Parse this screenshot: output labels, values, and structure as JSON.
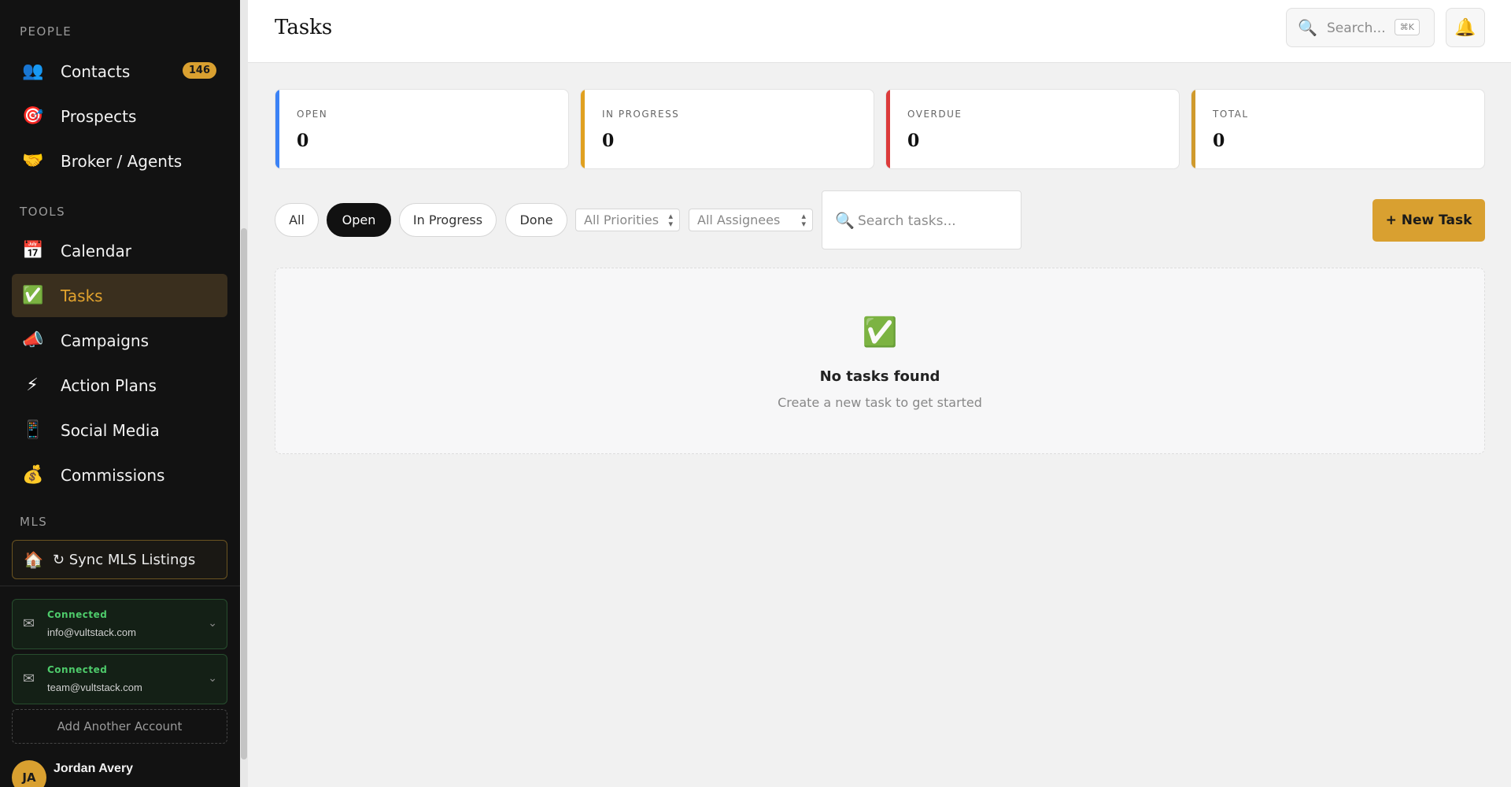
{
  "sidebar": {
    "sections": {
      "people": "PEOPLE",
      "tools": "TOOLS",
      "mls": "MLS"
    },
    "people_items": [
      {
        "icon": "👥",
        "label": "Contacts",
        "badge": "146"
      },
      {
        "icon": "🎯",
        "label": "Prospects"
      },
      {
        "icon": "🤝",
        "label": "Broker / Agents"
      }
    ],
    "tool_items": [
      {
        "icon": "📅",
        "label": "Calendar"
      },
      {
        "icon": "✅",
        "label": "Tasks",
        "active": true
      },
      {
        "icon": "📣",
        "label": "Campaigns"
      },
      {
        "icon": "⚡",
        "label": "Action Plans"
      },
      {
        "icon": "📱",
        "label": "Social Media"
      },
      {
        "icon": "💰",
        "label": "Commissions"
      }
    ],
    "mls_sync": {
      "icon": "🏠",
      "label": "↻ Sync MLS Listings"
    },
    "accounts": [
      {
        "status": "Connected",
        "email": "info@vultstack.com"
      },
      {
        "status": "Connected",
        "email": "team@vultstack.com"
      }
    ],
    "add_account": "Add Another Account",
    "user": {
      "initials": "JA",
      "name": "Jordan Avery"
    }
  },
  "header": {
    "title": "Tasks",
    "search_placeholder": "Search...",
    "search_shortcut": "⌘K"
  },
  "stats": [
    {
      "label": "OPEN",
      "value": "0",
      "color": "#3b82f6"
    },
    {
      "label": "IN PROGRESS",
      "value": "0",
      "color": "#e0a020"
    },
    {
      "label": "OVERDUE",
      "value": "0",
      "color": "#dc3b3b"
    },
    {
      "label": "TOTAL",
      "value": "0",
      "color": "#d09a2c"
    }
  ],
  "filters": {
    "statuses": [
      "All",
      "Open",
      "In Progress",
      "Done"
    ],
    "active_status": "Open",
    "priority_select": "All Priorities",
    "assignee_select": "All Assignees",
    "search_placeholder": "Search tasks..."
  },
  "new_task_label": "+ New Task",
  "empty_state": {
    "icon": "✅",
    "title": "No tasks found",
    "subtitle": "Create a new task to get started"
  },
  "colors": {
    "accent": "#d9a030",
    "sidebar_bg": "#121212",
    "connected": "#4ecb6b"
  }
}
